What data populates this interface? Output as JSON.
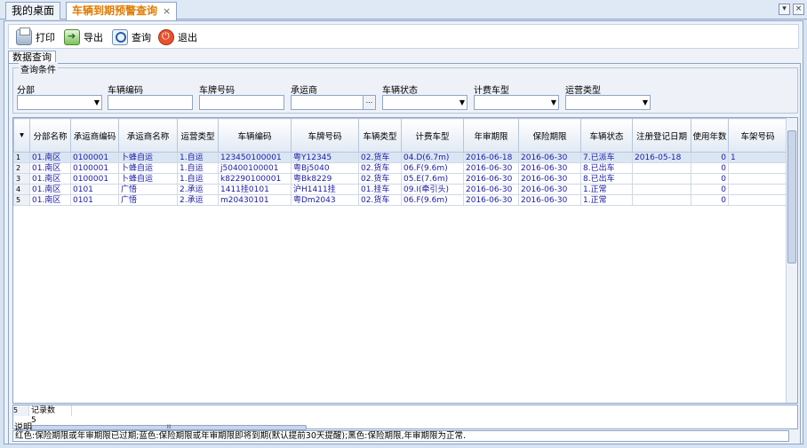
{
  "tabs": [
    {
      "label": "我的桌面"
    },
    {
      "label": "车辆到期预警查询",
      "close": "×"
    }
  ],
  "window_buttons": [
    "▾",
    "×"
  ],
  "toolbar": {
    "print_label": "打印",
    "export_label": "导出",
    "query_label": "查询",
    "exit_label": "退出"
  },
  "subtab": "数据查询",
  "query_conditions": {
    "title": "查询条件",
    "fields": [
      {
        "label": "分部",
        "value": ""
      },
      {
        "label": "车辆编码",
        "value": ""
      },
      {
        "label": "车牌号码",
        "value": ""
      },
      {
        "label": "承运商",
        "value": "",
        "button": "..."
      },
      {
        "label": "车辆状态",
        "value": ""
      },
      {
        "label": "计费车型",
        "value": ""
      },
      {
        "label": "运营类型",
        "value": ""
      }
    ]
  },
  "table": {
    "headers": [
      "分部名称",
      "承运商编码",
      "承运商名称",
      "运营类型",
      "车辆编码",
      "车牌号码",
      "车辆类型",
      "计费车型",
      "年审期限",
      "保险期限",
      "车辆状态",
      "注册登记日期",
      "使用年数",
      "车架号码"
    ],
    "rows": [
      {
        "n": "1",
        "cells": [
          "01.南区",
          "0100001",
          "卜蜂自运",
          "1.自运",
          "123450100001",
          "粤Y12345",
          "02.货车",
          "04.D(6.7m)",
          "2016-06-18",
          "2016-06-30",
          "7.已派车",
          "2016-05-18",
          "0",
          "1"
        ]
      },
      {
        "n": "2",
        "cells": [
          "01.南区",
          "0100001",
          "卜蜂自运",
          "1.自运",
          "j50400100001",
          "粤Bj5040",
          "02.货车",
          "06.F(9.6m)",
          "2016-06-30",
          "2016-06-30",
          "8.已出车",
          "",
          "0",
          ""
        ]
      },
      {
        "n": "3",
        "cells": [
          "01.南区",
          "0100001",
          "卜蜂自运",
          "1.自运",
          "k82290100001",
          "粤Bk8229",
          "02.货车",
          "05.E(7.6m)",
          "2016-06-30",
          "2016-06-30",
          "8.已出车",
          "",
          "0",
          ""
        ]
      },
      {
        "n": "4",
        "cells": [
          "01.南区",
          "0101",
          "广悟",
          "2.承运",
          "1411挂0101",
          "沪H1411挂",
          "01.挂车",
          "09.I(牵引头)",
          "2016-06-30",
          "2016-06-30",
          "1.正常",
          "",
          "0",
          ""
        ]
      },
      {
        "n": "5",
        "cells": [
          "01.南区",
          "0101",
          "广悟",
          "2.承运",
          "m20430101",
          "粤Dm2043",
          "02.货车",
          "06.F(9.6m)",
          "2016-06-30",
          "2016-06-30",
          "1.正常",
          "",
          "0",
          ""
        ]
      }
    ],
    "summary": {
      "row_num": "5",
      "label": "记录数",
      "count": "5"
    },
    "hscroll_mark": "III"
  },
  "description": {
    "title": "说明",
    "text": "红色:保险期限或年审期限已过期;蓝色:保险期限或年审期限即将到期(默认提前30天提醒);黑色:保险期限,年审期限为正常."
  }
}
